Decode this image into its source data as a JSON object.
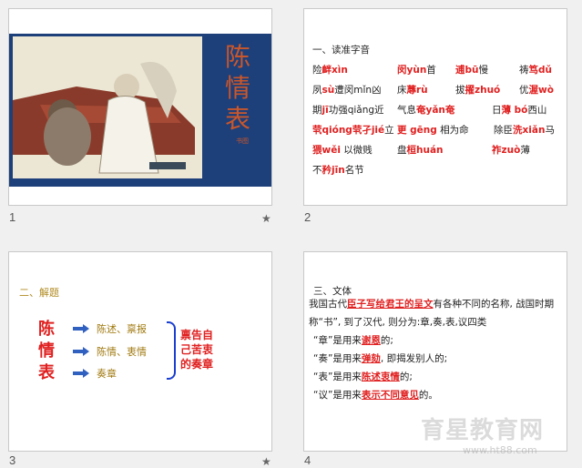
{
  "slides": [
    {
      "number": "1",
      "star": "★"
    },
    {
      "number": "2"
    },
    {
      "number": "3",
      "star": "★"
    },
    {
      "number": "4"
    }
  ],
  "slide1": {
    "title": "陈情表",
    "seal": "书图"
  },
  "slide2": {
    "heading": "一、读准字音",
    "rows": [
      [
        {
          "pre": "险",
          "red": "衅xìn"
        },
        {
          "pre": "",
          "red": "闵yùn",
          "post": "首"
        },
        {
          "pre": "",
          "red": "逋bū",
          "post": "慢"
        },
        {
          "pre": "祷",
          "red": "笃dǔ"
        }
      ],
      [
        {
          "pre": "夙",
          "red": "sù",
          "post": "遭闵mǐn凶"
        },
        {
          "pre": "床",
          "red": "蓐rù"
        },
        {
          "pre": "拔",
          "red": "擢zhuó"
        },
        {
          "pre": "优",
          "red": "渥wò"
        }
      ],
      [
        {
          "pre": "期",
          "red": "jī",
          "post": "功强qiǎng近"
        },
        {
          "pre": "气息",
          "red": "奄yǎn奄"
        },
        {
          "pre": "日",
          "red": "薄 bó",
          "post": "西山"
        }
      ],
      [
        {
          "pre": "",
          "red": "茕qióng茕孑jié",
          "post": "立"
        },
        {
          "pre": "",
          "red": "更 gēng",
          "post": " 相为命"
        },
        {
          "pre": "除臣",
          "red": "洗xiǎn",
          "post": "马"
        }
      ],
      [
        {
          "pre": "",
          "red": "猥wěi",
          "post": " 以微贱"
        },
        {
          "pre": "盘",
          "red": "桓huán"
        },
        {
          "pre": "",
          "red": "祚zuò",
          "post": "薄"
        }
      ],
      [
        {
          "pre": "不",
          "red": "矜jīn",
          "post": "名节"
        }
      ]
    ]
  },
  "slide3": {
    "heading": "二、解题",
    "title": "陈情表",
    "items": [
      "陈述、禀报",
      "陈情、衷情",
      "奏章"
    ],
    "note": "禀告自己苦衷的奏章"
  },
  "slide4": {
    "heading": "三、文体",
    "line1a": "我国古代",
    "line1b": "臣子写给君王的呈文",
    "line1c": "有各种不同的名称, 战国时期",
    "line2": "称“书”, 到了汉代, 则分为:章,奏,表,议四类",
    "defs": [
      {
        "a": "“章”是用来",
        "b": "谢恩",
        "c": "的;"
      },
      {
        "a": "“奏”是用来",
        "b": "弹劾",
        "c": ", 即揭发别人的;"
      },
      {
        "a": "“表”是用来",
        "b": "陈述衷情",
        "c": "的;"
      },
      {
        "a": "“议”是用来",
        "b": "表示不同意见",
        "c": "的。"
      }
    ]
  },
  "watermark": {
    "text": "育星教育网",
    "url": "www.ht88.com"
  },
  "colors": {
    "accent_red": "#e02020",
    "brace_blue": "#1a3fd0",
    "title_bg": "#1d3f7a",
    "heading_gold": "#b08a20"
  }
}
